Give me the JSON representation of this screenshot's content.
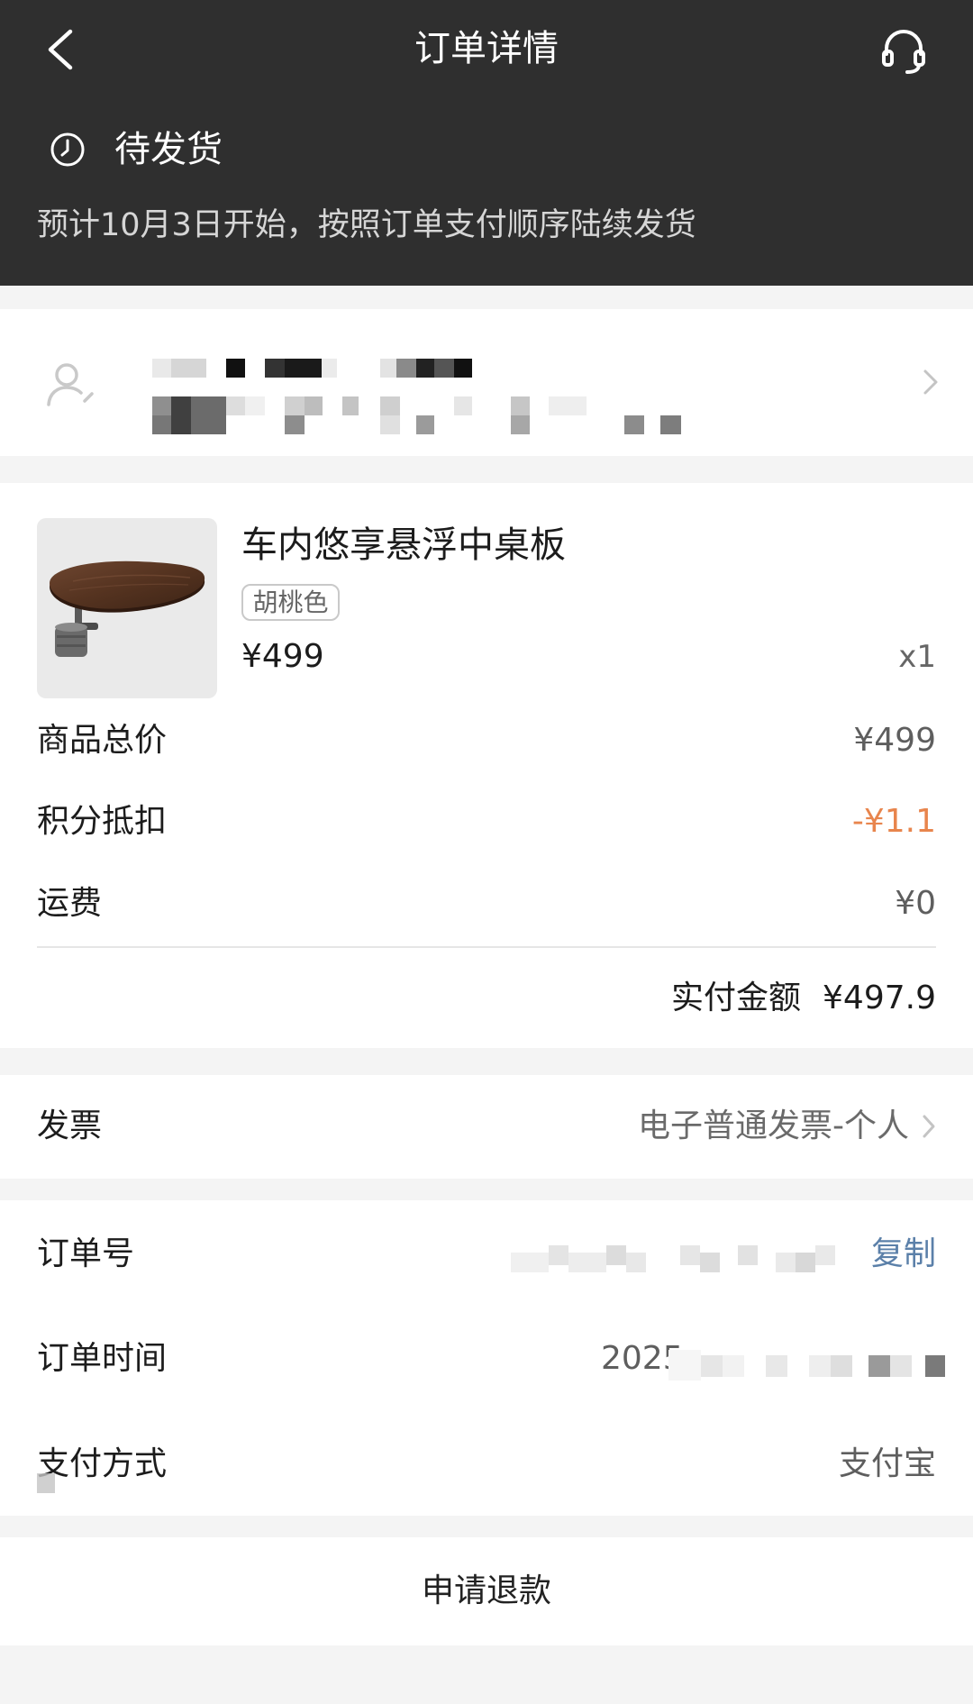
{
  "header": {
    "title": "订单详情",
    "back_icon": "back-icon",
    "service_icon": "headset-icon",
    "background": "#2f2f2f"
  },
  "status": {
    "icon": "clock-icon",
    "title": "待发货",
    "description": "预计10月3日开始，按照订单支付顺序陆续发货"
  },
  "address": {
    "icon": "person-icon",
    "arrow_icon": "chevron-right-icon"
  },
  "product": {
    "image_icon": "walnut-table-tray-image",
    "name": "车内悠享悬浮中桌板",
    "variant": "胡桃色",
    "price": "¥499",
    "quantity": "x1"
  },
  "summary": {
    "rows": [
      {
        "label": "商品总价",
        "value": "¥499"
      },
      {
        "label": "积分抵扣",
        "value": "-¥1.1"
      },
      {
        "label": "运费",
        "value": "¥0"
      }
    ],
    "total_label": "实付金额",
    "total_value": "¥497.9"
  },
  "invoice": {
    "label": "发票",
    "value": "电子普通发票-个人",
    "arrow_icon": "chevron-right-icon"
  },
  "order_info": {
    "order_no_label": "订单号",
    "copy_label": "复制",
    "time_label": "订单时间",
    "time_value_visible": "2025",
    "payment_label": "支付方式",
    "payment_value": "支付宝"
  },
  "footer": {
    "refund_label": "申请退款"
  },
  "colors": {
    "page_bg": "#f4f4f4",
    "accent_orange": "#e8854d",
    "link_blue": "#5b80a9"
  }
}
